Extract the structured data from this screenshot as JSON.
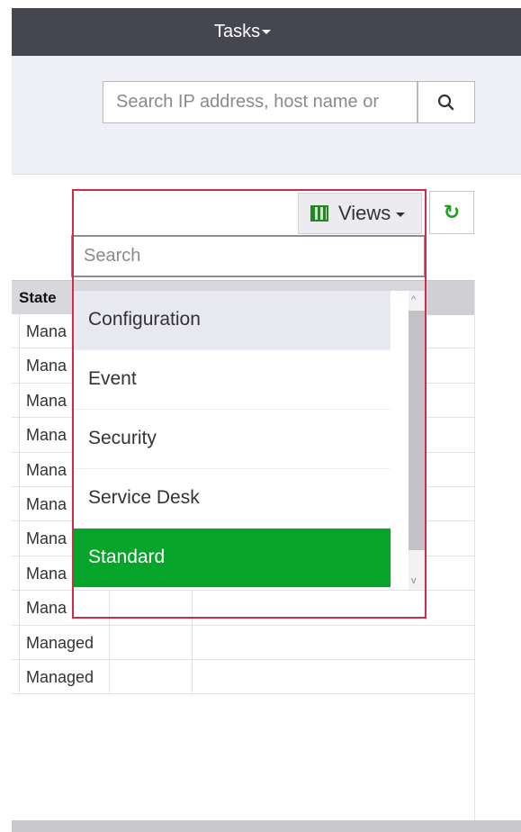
{
  "header": {
    "tasks_label": "Tasks"
  },
  "search": {
    "placeholder": "Search IP address, host name or"
  },
  "toolbar": {
    "views_label": "Views",
    "refresh_icon": "↻"
  },
  "table": {
    "columns": [
      "State"
    ],
    "rows": [
      {
        "state": "Mana"
      },
      {
        "state": "Mana"
      },
      {
        "state": "Mana"
      },
      {
        "state": "Mana"
      },
      {
        "state": "Mana"
      },
      {
        "state": "Mana"
      },
      {
        "state": "Mana"
      },
      {
        "state": "Mana"
      },
      {
        "state": "Mana"
      },
      {
        "state": "Managed"
      },
      {
        "state": "Managed"
      }
    ]
  },
  "views_dropdown": {
    "search_placeholder": "Search",
    "items": [
      {
        "label": "Configuration"
      },
      {
        "label": "Event"
      },
      {
        "label": "Security"
      },
      {
        "label": "Service Desk"
      },
      {
        "label": "Standard"
      }
    ],
    "hovered_item": "Configuration",
    "selected_item": "Standard",
    "colors": {
      "selected": "#06a52a",
      "highlight_border": "#d12a4a",
      "topbar": "#464650"
    }
  }
}
